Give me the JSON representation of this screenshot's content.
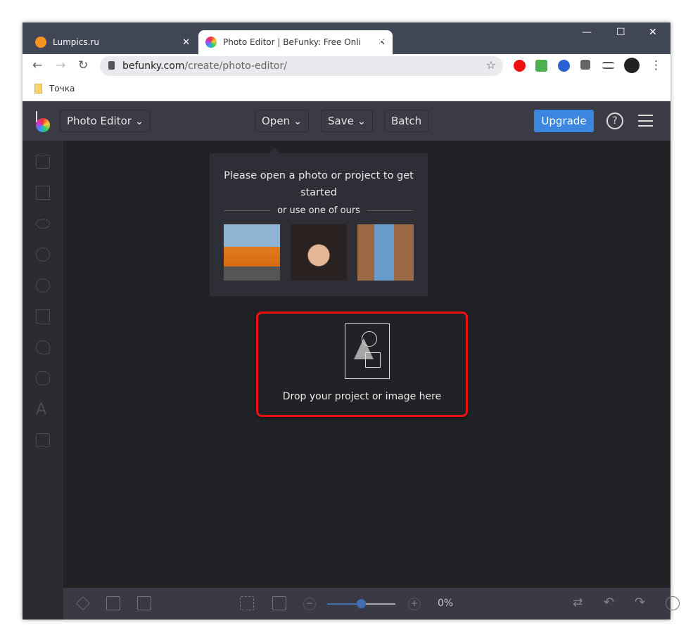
{
  "browser": {
    "tabs": [
      {
        "title": "Lumpics.ru",
        "active": false
      },
      {
        "title": "Photo Editor | BeFunky: Free Onli",
        "active": true
      }
    ],
    "url_host": "befunky.com",
    "url_path": "/create/photo-editor/",
    "bookmarks": [
      {
        "label": "Точка"
      }
    ]
  },
  "header": {
    "app_menu": "Photo Editor ⌄",
    "open": "Open ⌄",
    "save": "Save ⌄",
    "batch": "Batch",
    "upgrade": "Upgrade",
    "help": "?"
  },
  "popup": {
    "title": "Please open a photo or project to get started",
    "or": "or use one of ours"
  },
  "drop": {
    "label": "Drop your project or image here"
  },
  "zoom": {
    "value": "0%",
    "slider_fraction": 0.5
  },
  "colors": {
    "accent": "#3d86e0",
    "highlight": "#e11111"
  }
}
